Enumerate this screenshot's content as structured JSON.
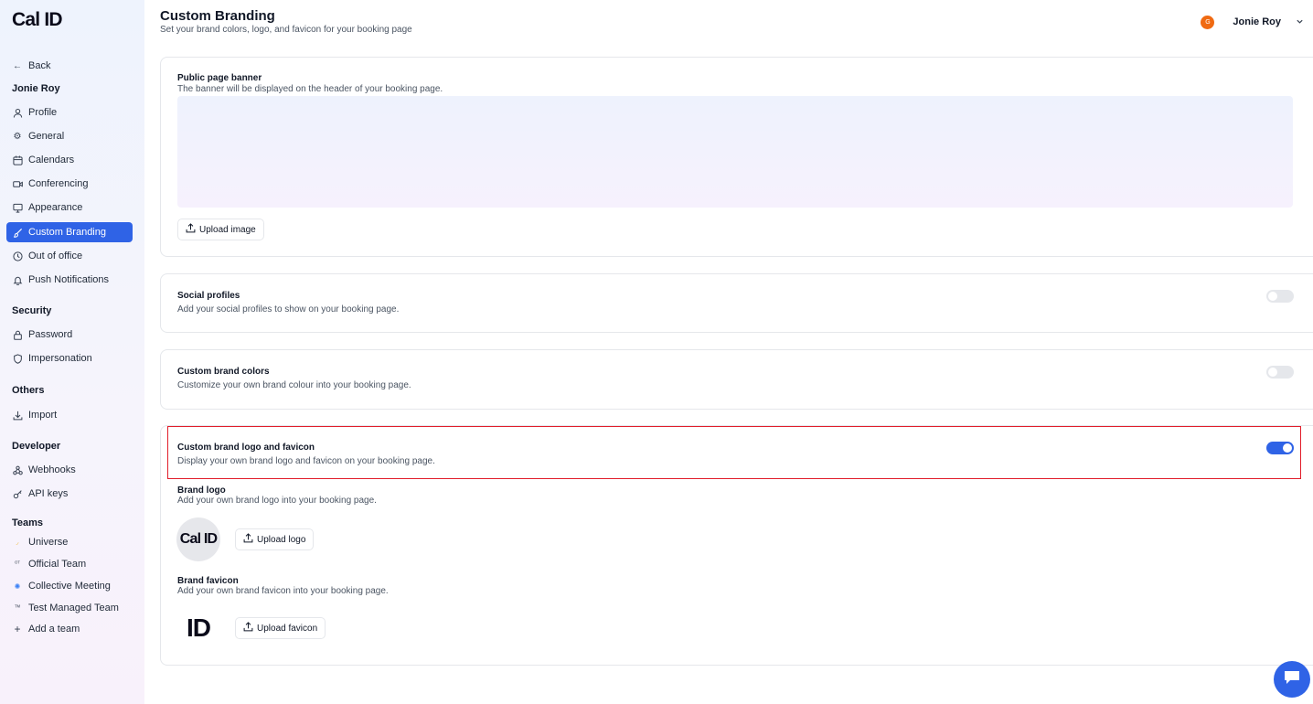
{
  "app": {
    "brand": "Cal ID"
  },
  "sidebar": {
    "back_label": "Back",
    "user_name": "Jonie Roy",
    "account_items": [
      {
        "label": "Profile",
        "icon": "user-icon"
      },
      {
        "label": "General",
        "icon": "gear-icon"
      },
      {
        "label": "Calendars",
        "icon": "calendar-icon"
      },
      {
        "label": "Conferencing",
        "icon": "video-icon"
      },
      {
        "label": "Appearance",
        "icon": "monitor-icon"
      },
      {
        "label": "Custom Branding",
        "icon": "brush-icon",
        "active": true
      },
      {
        "label": "Out of office",
        "icon": "clock-icon"
      },
      {
        "label": "Push Notifications",
        "icon": "bell-icon"
      }
    ],
    "security_heading": "Security",
    "security_items": [
      {
        "label": "Password",
        "icon": "lock-icon"
      },
      {
        "label": "Impersonation",
        "icon": "shield-icon"
      }
    ],
    "others_heading": "Others",
    "others_items": [
      {
        "label": "Import",
        "icon": "download-icon"
      }
    ],
    "developer_heading": "Developer",
    "developer_items": [
      {
        "label": "Webhooks",
        "icon": "webhook-icon"
      },
      {
        "label": "API keys",
        "icon": "key-icon"
      }
    ],
    "teams_heading": "Teams",
    "teams_items": [
      {
        "label": "Universe",
        "icon": "team-avatar-icon"
      },
      {
        "label": "Official Team",
        "icon": "team-avatar-icon"
      },
      {
        "label": "Collective Meeting",
        "icon": "team-avatar-icon"
      },
      {
        "label": "Test Managed Team",
        "icon": "team-avatar-icon"
      },
      {
        "label": "Add a team",
        "icon": "plus-icon"
      }
    ]
  },
  "header": {
    "title": "Custom Branding",
    "subtitle": "Set your brand colors, logo, and favicon for your booking page",
    "user_initial": "G",
    "user_name": "Jonie Roy"
  },
  "banner_card": {
    "title": "Public page banner",
    "description": "The banner will be displayed on the header of your booking page.",
    "upload_label": "Upload image"
  },
  "social_card": {
    "title": "Social profiles",
    "description": "Add your social profiles to show on your booking page.",
    "enabled": false
  },
  "colors_card": {
    "title": "Custom brand colors",
    "description": "Customize your own brand colour into your booking page.",
    "enabled": false
  },
  "logo_card": {
    "title": "Custom brand logo and favicon",
    "description": "Display your own brand logo and favicon on your booking page.",
    "enabled": true,
    "logo_title": "Brand logo",
    "logo_description": "Add your own brand logo into your booking page.",
    "logo_preview": "Cal ID",
    "upload_logo_label": "Upload logo",
    "favicon_title": "Brand favicon",
    "favicon_description": "Add your own brand favicon into your booking page.",
    "favicon_preview": "ID",
    "upload_favicon_label": "Upload favicon"
  },
  "colors": {
    "accent": "#2f63e6",
    "highlight": "#e11d2a",
    "avatar": "#f06a12"
  }
}
